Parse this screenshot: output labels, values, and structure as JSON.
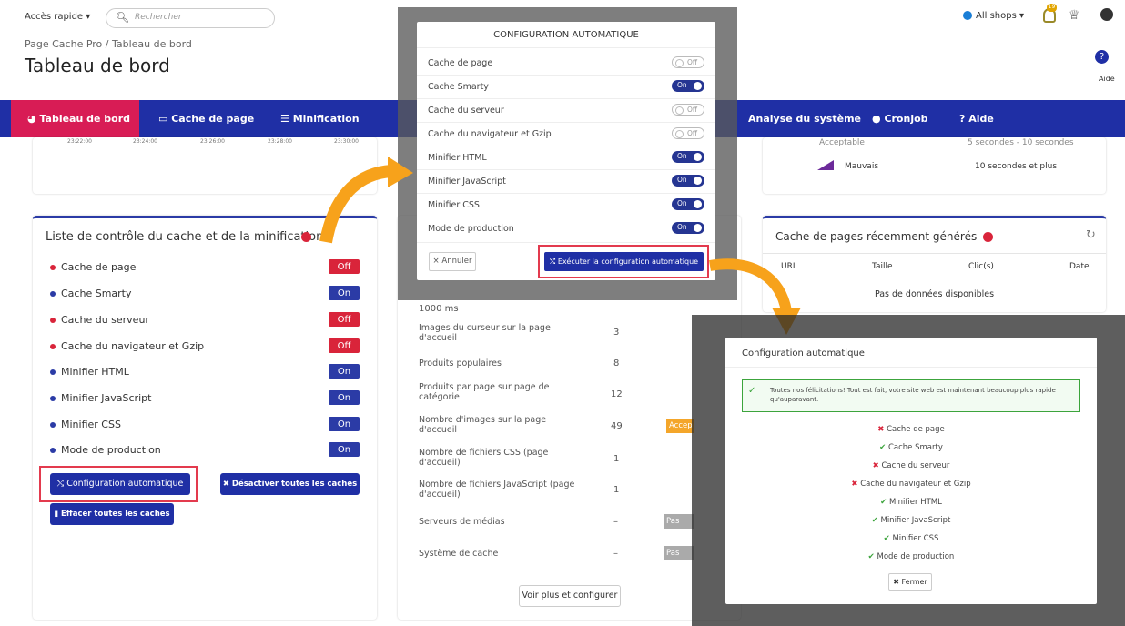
{
  "topbar": {
    "quick_access": "Accès rapide ▾",
    "search_placeholder": "Rechercher",
    "all_shops": "All shops ▾",
    "notif_count": "19"
  },
  "breadcrumb": "Page Cache Pro  /  Tableau de bord",
  "page_title": "Tableau de bord",
  "help_label": "Aide",
  "nav": {
    "items": [
      "Tableau de bord",
      "Cache de page",
      "Minification",
      "Analyse du système",
      "Cronjob",
      "Aide"
    ]
  },
  "chart_times": [
    "23:22:00",
    "23:24:00",
    "23:26:00",
    "23:28:00",
    "23:30:00"
  ],
  "speed_legend": {
    "acceptable": "Acceptable",
    "acceptable_val": "5 secondes - 10 secondes",
    "bad": "Mauvais",
    "bad_val": "10 secondes et plus"
  },
  "checklist": {
    "title": "Liste de contrôle du cache et de la minification",
    "items": [
      {
        "label": "Cache de page",
        "status": "Off"
      },
      {
        "label": "Cache Smarty",
        "status": "On"
      },
      {
        "label": "Cache du serveur",
        "status": "Off"
      },
      {
        "label": "Cache du navigateur et Gzip",
        "status": "Off"
      },
      {
        "label": "Minifier HTML",
        "status": "On"
      },
      {
        "label": "Minifier JavaScript",
        "status": "On"
      },
      {
        "label": "Minifier CSS",
        "status": "On"
      },
      {
        "label": "Mode de production",
        "status": "On"
      }
    ],
    "auto_config_btn": "Configuration automatique",
    "disable_all_btn": "Désactiver toutes les caches",
    "clear_all_btn": "Effacer toutes les caches"
  },
  "middle": {
    "first_val": "1000 ms",
    "rows": [
      {
        "label": "Images du curseur sur la page d'accueil",
        "value": "3"
      },
      {
        "label": "Produits populaires",
        "value": "8"
      },
      {
        "label": "Produits par page sur page de catégorie",
        "value": "12"
      },
      {
        "label": "Nombre d'images sur la page d'accueil",
        "value": "49"
      },
      {
        "label": "Nombre de fichiers CSS (page d'accueil)",
        "value": "1"
      },
      {
        "label": "Nombre de fichiers JavaScript (page d'accueil)",
        "value": "1"
      },
      {
        "label": "Serveurs de médias",
        "value": "–"
      },
      {
        "label": "Système de cache",
        "value": "–"
      }
    ],
    "accept_badge": "Accep",
    "pas_badge": "Pas con",
    "more_btn": "Voir plus et configurer"
  },
  "recent": {
    "title": "Cache de pages récemment générés",
    "cols": [
      "URL",
      "Taille",
      "Clic(s)",
      "Date"
    ],
    "empty": "Pas de données disponibles"
  },
  "modal1": {
    "title": "CONFIGURATION AUTOMATIQUE",
    "rows": [
      {
        "label": "Cache de page",
        "state": "Off"
      },
      {
        "label": "Cache Smarty",
        "state": "On"
      },
      {
        "label": "Cache du serveur",
        "state": "Off"
      },
      {
        "label": "Cache du navigateur et Gzip",
        "state": "Off"
      },
      {
        "label": "Minifier HTML",
        "state": "On"
      },
      {
        "label": "Minifier JavaScript",
        "state": "On"
      },
      {
        "label": "Minifier CSS",
        "state": "On"
      },
      {
        "label": "Mode de production",
        "state": "On"
      }
    ],
    "cancel": "Annuler",
    "run": "Exécuter la configuration automatique"
  },
  "modal2": {
    "title": "Configuration automatique",
    "success": "Toutes nos félicitations! Tout est fait, votre site web est maintenant beaucoup plus rapide qu'auparavant.",
    "results": [
      {
        "label": "Cache de page",
        "ok": false
      },
      {
        "label": "Cache Smarty",
        "ok": true
      },
      {
        "label": "Cache du serveur",
        "ok": false
      },
      {
        "label": "Cache du navigateur et Gzip",
        "ok": false
      },
      {
        "label": "Minifier HTML",
        "ok": true
      },
      {
        "label": "Minifier JavaScript",
        "ok": true
      },
      {
        "label": "Minifier CSS",
        "ok": true
      },
      {
        "label": "Mode de production",
        "ok": true
      }
    ],
    "close": "Fermer"
  },
  "colors": {
    "primary": "#1f2fa5",
    "danger": "#d9243a",
    "active_tab": "#d81c55",
    "success": "#3ca43c",
    "highlight": "#e33a4e",
    "arrow": "#f7a21b"
  }
}
